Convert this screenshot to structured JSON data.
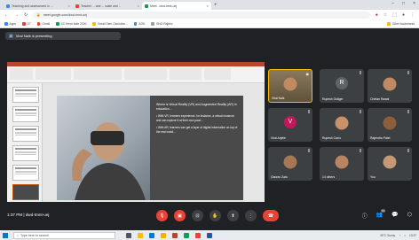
{
  "browser": {
    "tabs": [
      {
        "title": "Teaching and assessment in ...",
        "fav_color": "#4285f4",
        "active": false
      },
      {
        "title": "Teacher ... and ... scale and ...",
        "fav_color": "#ea4335",
        "active": false
      },
      {
        "title": "Meet - dwd-tmnt-uej",
        "fav_color": "#0f9d58",
        "active": true
      }
    ],
    "new_tab": "+",
    "url": "meet.google.com/dwd-tmnt-uej",
    "bookmarks": [
      {
        "label": "Apps",
        "color": "#4285f4"
      },
      {
        "label": "DT",
        "color": "#db4437"
      },
      {
        "label": "Gmail",
        "color": "#ea4335"
      },
      {
        "label": "SC Hmm.bdm 2020",
        "color": "#0f9d58"
      },
      {
        "label": "Gmail Sem Gsolution...",
        "color": "#fbbc04"
      },
      {
        "label": "AOK",
        "color": "#4285f4"
      },
      {
        "label": "GNO Rajeev",
        "color": "#9e9e9e"
      }
    ],
    "other_bookmarks": "Other bookmarks"
  },
  "meet": {
    "presenting_label": "Viral Naik is presenting",
    "meeting_time": "1:37 PM",
    "meeting_code": "dwd-tmnt-uej",
    "participant_count": "13"
  },
  "slide": {
    "heading": "Where is Virtual Reality (VR) and Augmented Reality (AR) in education...",
    "paragraphs": [
      "• With VR, learners experience, for instance, a virtual museum and can explore it at their own pace...",
      "• With AR, learners can get a layer of digital information on top of the real world..."
    ]
  },
  "participants": [
    {
      "name": "Viral Naik",
      "type": "video",
      "highlight": true
    },
    {
      "name": "Rupesh Gidiger",
      "type": "avatar",
      "initial": "R",
      "color": "#5f6368"
    },
    {
      "name": "Chetan Rawal",
      "type": "video"
    },
    {
      "name": "Viral Anjele",
      "type": "avatar",
      "initial": "V",
      "color": "#c2185b"
    },
    {
      "name": "Rupesh Carro",
      "type": "video"
    },
    {
      "name": "Rajendra Patel",
      "type": "video"
    },
    {
      "name": "Gaurav Zala",
      "type": "video"
    },
    {
      "name": "14 others",
      "type": "video"
    },
    {
      "name": "You",
      "type": "video"
    }
  ],
  "taskbar": {
    "search_placeholder": "Type here to search",
    "tray_text": "30°C Sunny",
    "clock": "13:37"
  },
  "icons": {
    "mic": "mic-icon",
    "camera": "camera-icon",
    "captions": "captions-icon",
    "raise_hand": "hand-icon",
    "present": "present-icon",
    "more": "more-icon",
    "leave": "leave-call-icon"
  }
}
